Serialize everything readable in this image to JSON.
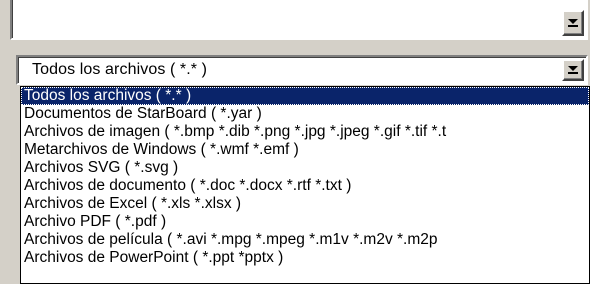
{
  "top_combo": {
    "value": ""
  },
  "filter_combo": {
    "value": "Todos los archivos ( *.* )"
  },
  "dropdown": {
    "items": [
      {
        "label": "Todos los archivos ( *.* )",
        "selected": true
      },
      {
        "label": "Documentos de StarBoard ( *.yar )",
        "selected": false
      },
      {
        "label": "Archivos de imagen ( *.bmp *.dib *.png *.jpg *.jpeg *.gif *.tif *.t",
        "selected": false
      },
      {
        "label": "Metarchivos de Windows ( *.wmf *.emf )",
        "selected": false
      },
      {
        "label": "Archivos SVG ( *.svg )",
        "selected": false
      },
      {
        "label": "Archivos de documento ( *.doc *.docx *.rtf *.txt )",
        "selected": false
      },
      {
        "label": "Archivos de Excel ( *.xls *.xlsx )",
        "selected": false
      },
      {
        "label": "Archivo PDF ( *.pdf )",
        "selected": false
      },
      {
        "label": "Archivos de película ( *.avi *.mpg *.mpeg *.m1v *.m2v *.m2p",
        "selected": false
      },
      {
        "label": "Archivos de PowerPoint ( *.ppt *pptx )",
        "selected": false
      }
    ]
  },
  "colors": {
    "selection_bg": "#0a246a",
    "selection_fg": "#ffffff",
    "face": "#d4d0c8"
  },
  "icons": {
    "dropdown_button": "chevron-down-icon"
  }
}
